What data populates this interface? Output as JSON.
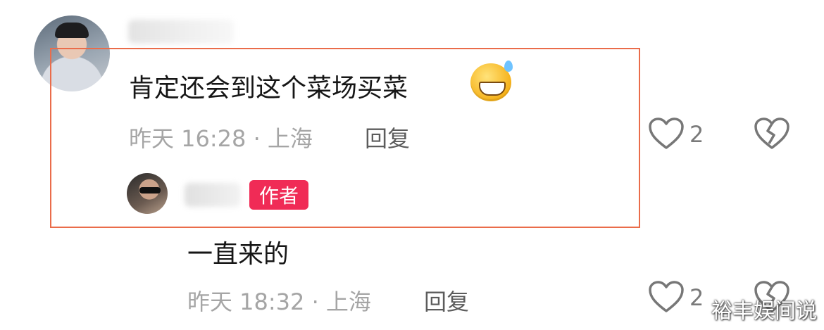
{
  "comment": {
    "text": "肯定还会到这个菜场买菜",
    "time_location": "昨天 16:28 · 上海",
    "reply_label": "回复",
    "like_count": "2"
  },
  "reply": {
    "badge": "作者",
    "text": "一直来的",
    "time_location": "昨天 18:32 · 上海",
    "reply_label": "回复",
    "like_count": "2"
  },
  "icons": {
    "like": "heart-outline-icon",
    "dislike": "broken-heart-icon",
    "emoji": "grin-sweat-emoji"
  },
  "colors": {
    "highlight_box": "#ea6c4a",
    "author_badge": "#f02b56",
    "meta_text": "#a5a5a5"
  },
  "watermark": "裕丰娱间说"
}
